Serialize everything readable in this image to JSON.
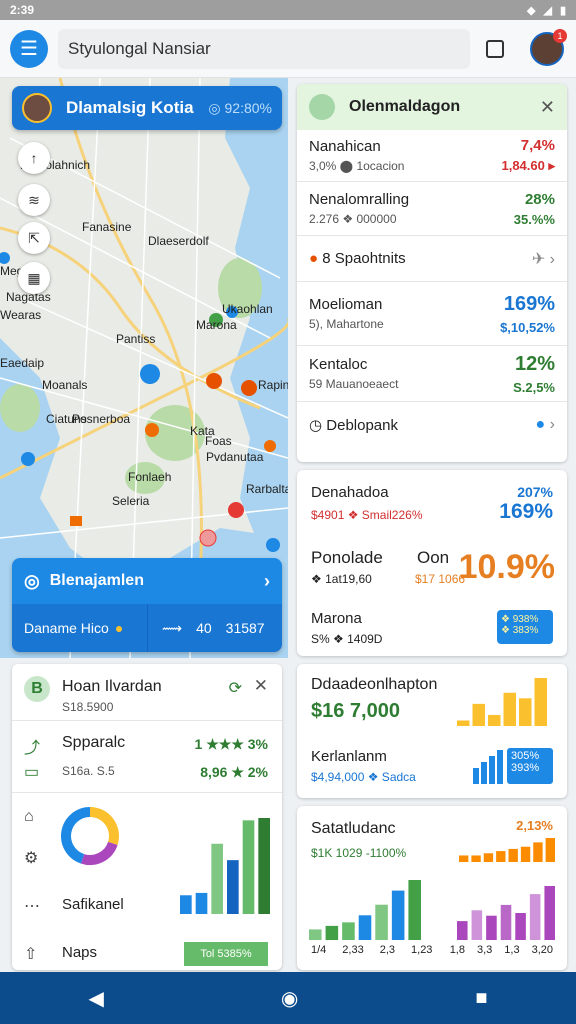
{
  "status": {
    "time": "2:39"
  },
  "topbar": {
    "search_text": "Styulongal Nansiar",
    "notif_count": "1"
  },
  "map": {
    "card_name": "Dlamalsig Kotia",
    "card_value": "◎ 92:80%",
    "labels": [
      "Nomolahnich",
      "Fanasine",
      "Dlaeserdolf",
      "Meglanr",
      "Nagatas",
      "Ukaohlan",
      "Pantiss",
      "Eaedaip",
      "Moanals",
      "Rapinetel",
      "Posnerboa",
      "Kata",
      "Ciatuns",
      "Foas",
      "Pvdanutaa",
      "Fonlaeh",
      "Rarbalta",
      "Seleria",
      "Marona",
      "Wearas"
    ]
  },
  "nav_card": {
    "title": "Blenajamlen",
    "left_text": "Daname Hico",
    "right_arrow": "⟿",
    "right_num": "40",
    "right_val": "31587"
  },
  "card1": {
    "title": "Olenmaldagon",
    "rows": [
      {
        "l1": "Nanahican",
        "l2": "3,0%  ⬤ 1ocacion",
        "r1": "7,4%",
        "r2": "1,84.60 ▸"
      },
      {
        "l1": "Nenalomralling",
        "l2": "2.276 ❖ 000000",
        "r1": "28%",
        "r2": "35.%%"
      },
      {
        "l1": "8  Spaohtnits",
        "l2": "",
        "r1": "",
        "r2": ""
      },
      {
        "l1": "Moelioman",
        "l2": "5), Mahartone",
        "r1": "169%",
        "r2": "$,10,52%"
      },
      {
        "l1": "Kentaloc",
        "l2": "59  Mauanoeaect",
        "r1": "12%",
        "r2": "S.2,5%"
      },
      {
        "l1": "Deblopank",
        "l2": "",
        "r1": "",
        "r2": ""
      }
    ]
  },
  "card2": {
    "r1_title": "Denahadoa",
    "r1_sub": "$4901 ❖  Smail226%",
    "r1_pct": "207%",
    "r1_big": "169%",
    "r2_title": "Ponolade",
    "r2_mid": "Oon",
    "r2_sub": "❖ 1at19,60",
    "r2_mid2": "$17 1066",
    "r2_big": "10.9%",
    "r3_title": "Marona",
    "r3_sub": "S%  ❖ 1409D",
    "r3_badge_a": "❖ 938%",
    "r3_badge_b": "❖ 383%"
  },
  "card3": {
    "r1_title": "Ddaadeonlhapton",
    "r1_val": "$16 7,000",
    "r2_title": "Kerlanlanm",
    "r2_sub": "$4,94,000 ❖ Sadca",
    "r2_badge_a": "305%",
    "r2_badge_b": "393%"
  },
  "card4": {
    "title": "Satatludanc",
    "sub": "$1K 1029 -1100%",
    "right_pct": "2,13%",
    "xlabels_left": [
      "1/4",
      "2,33",
      "2,3",
      "1,23"
    ],
    "xlabels_right": [
      "1,8",
      "3,3",
      "1,3",
      "3,20"
    ]
  },
  "card5": {
    "title": "Hoan Ilvardan",
    "sub": "S18.5900",
    "r1": "Spparalc",
    "r1_sub": "S16a. S.5",
    "r1_r1": "1 ★★★ 3%",
    "r1_r2": "8,96 ★ 2%",
    "r2": "Safikanel",
    "r3": "Naps",
    "r3_badge": "Tol 5385%"
  },
  "chart_data": [
    {
      "type": "bar",
      "title": "",
      "values": [
        3,
        12,
        6,
        18,
        15,
        26
      ]
    },
    {
      "type": "bar",
      "title": "",
      "values": [
        6,
        8,
        10,
        14,
        20,
        28,
        34
      ]
    },
    {
      "type": "bar",
      "title": "",
      "values": [
        10,
        16,
        22,
        30
      ]
    }
  ]
}
